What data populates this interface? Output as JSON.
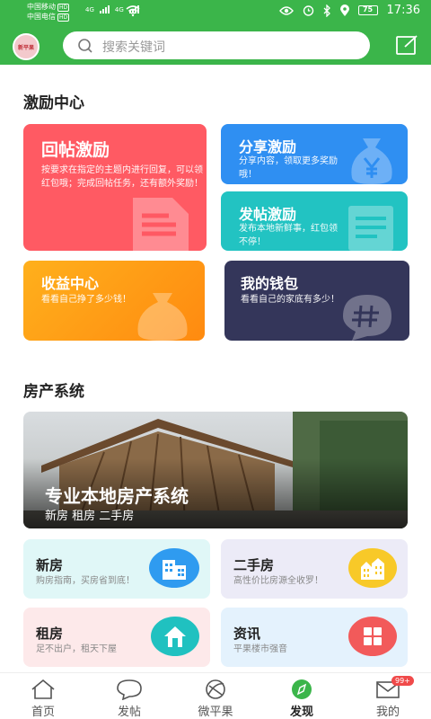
{
  "status_bar": {
    "carrier1": "中国移动",
    "carrier2": "中国电信",
    "hd": "HD",
    "net1": "4G",
    "net2": "4G",
    "battery": "75",
    "time": "17:36"
  },
  "header": {
    "avatar_text": "新平果",
    "search_placeholder": "搜索关键词"
  },
  "incentive": {
    "section_title": "激励中心",
    "reply": {
      "title": "回帖激励",
      "desc": "按要求在指定的主题内进行回复，可以领红包哦；完成回帖任务，还有额外奖励！"
    },
    "share": {
      "title": "分享激励",
      "desc": "分享内容，领取更多奖励哦！"
    },
    "post": {
      "title": "发帖激励",
      "desc": "发布本地新鲜事，红包领不停！"
    },
    "income": {
      "title": "收益中心",
      "desc": "看看自己挣了多少钱！"
    },
    "wallet": {
      "title": "我的钱包",
      "desc": "看看自己的家底有多少！"
    }
  },
  "property": {
    "section_title": "房产系统",
    "banner_title": "专业本地房产系统",
    "banner_subtitle": "新房 租房 二手房",
    "new_house": {
      "title": "新房",
      "desc": "购房指南，买房省到底！"
    },
    "second_hand": {
      "title": "二手房",
      "desc": "高性价比房源全收罗！"
    },
    "rent": {
      "title": "租房",
      "desc": "足不出户，租天下屋"
    },
    "news": {
      "title": "资讯",
      "desc": "平果楼市强音"
    }
  },
  "tabs": [
    {
      "label": "首页",
      "icon": "home-icon"
    },
    {
      "label": "发帖",
      "icon": "chat-bubble-icon"
    },
    {
      "label": "微平果",
      "icon": "orbit-icon"
    },
    {
      "label": "发现",
      "icon": "compass-icon"
    },
    {
      "label": "我的",
      "icon": "mail-icon"
    }
  ],
  "message_badge": "99+",
  "colors": {
    "brand_green": "#3bb54a",
    "reply_red": "#ff5a63",
    "share_blue": "#2f8ff2",
    "post_teal": "#22c3c2",
    "income_orange": "#ff9e14",
    "wallet_navy": "#34365a"
  }
}
